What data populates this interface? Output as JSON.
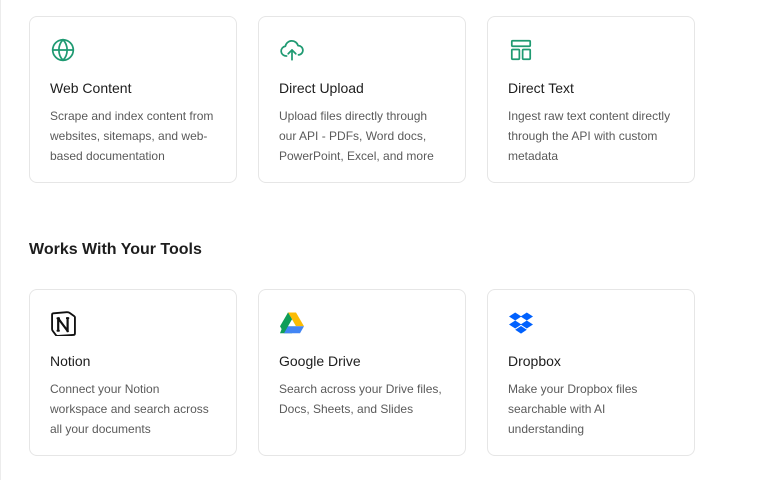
{
  "colors": {
    "accent": "#1f9a72",
    "border": "#e6e6e6",
    "text_primary": "#1d1d1d",
    "text_secondary": "#5a5a5a"
  },
  "sources": [
    {
      "icon": "globe-icon",
      "title": "Web Content",
      "description": "Scrape and index content from websites, sitemaps, and web-based documentation"
    },
    {
      "icon": "cloud-upload-icon",
      "title": "Direct Upload",
      "description": "Upload files directly through our API - PDFs, Word docs, PowerPoint, Excel, and more"
    },
    {
      "icon": "layout-icon",
      "title": "Direct Text",
      "description": "Ingest raw text content directly through the API with custom metadata"
    }
  ],
  "tools_section": {
    "title": "Works With Your Tools"
  },
  "tools": [
    {
      "icon": "notion-icon",
      "title": "Notion",
      "description": "Connect your Notion workspace and search across all your documents"
    },
    {
      "icon": "google-drive-icon",
      "title": "Google Drive",
      "description": "Search across your Drive files, Docs, Sheets, and Slides"
    },
    {
      "icon": "dropbox-icon",
      "title": "Dropbox",
      "description": "Make your Dropbox files searchable with AI understanding"
    }
  ]
}
